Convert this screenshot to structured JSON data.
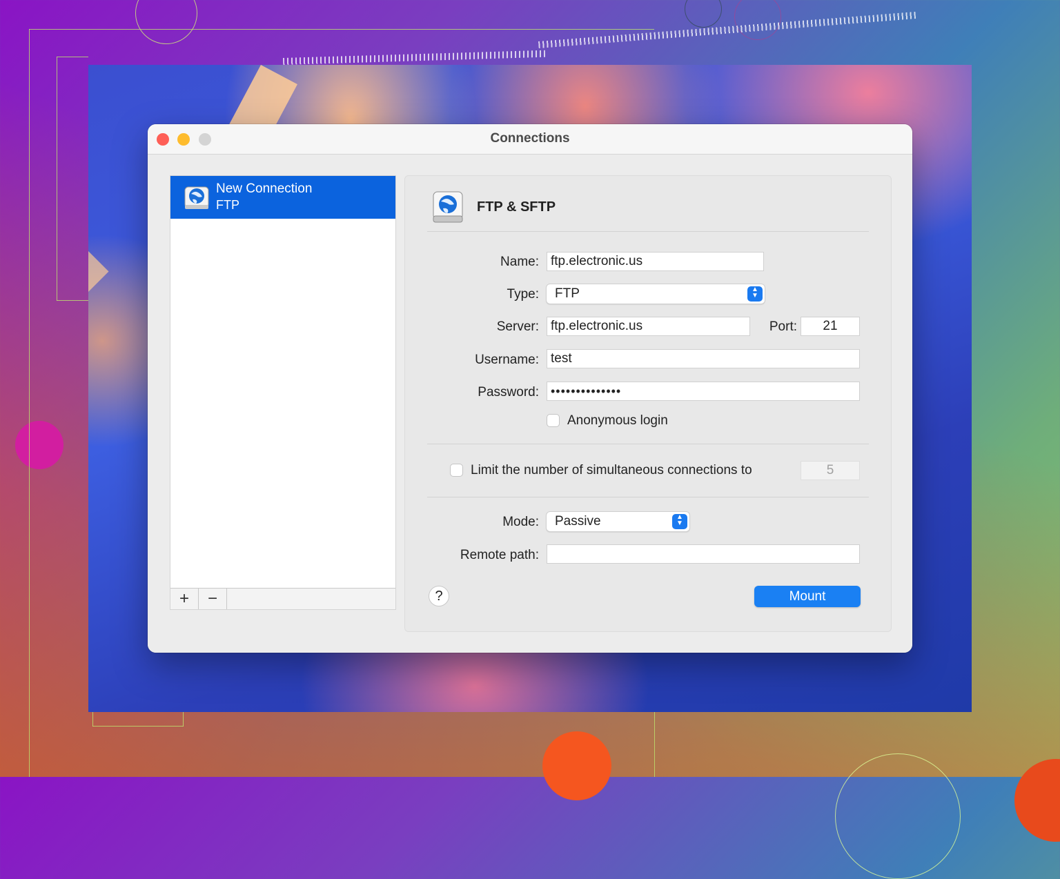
{
  "window": {
    "title": "Connections"
  },
  "sidebar": {
    "items": [
      {
        "name": "New Connection",
        "type": "FTP"
      }
    ],
    "add_label": "+",
    "remove_label": "−"
  },
  "panel": {
    "title": "FTP & SFTP",
    "labels": {
      "name": "Name:",
      "type": "Type:",
      "server": "Server:",
      "port": "Port:",
      "username": "Username:",
      "password": "Password:",
      "mode": "Mode:",
      "remote_path": "Remote path:"
    },
    "values": {
      "name": "ftp.electronic.us",
      "type": "FTP",
      "server": "ftp.electronic.us",
      "port": "21",
      "username": "test",
      "password": "••••••••••••••",
      "mode": "Passive",
      "remote_path": ""
    },
    "anonymous_label": "Anonymous login",
    "anonymous_checked": false,
    "limit_label": "Limit the number of simultaneous connections to",
    "limit_checked": false,
    "limit_value": "5",
    "help_label": "?",
    "mount_label": "Mount"
  },
  "colors": {
    "accent": "#1a80f3",
    "selection": "#0b63de",
    "close": "#fe5f57",
    "minimize": "#febc2e",
    "zoom_inactive": "#d4d4d4"
  }
}
